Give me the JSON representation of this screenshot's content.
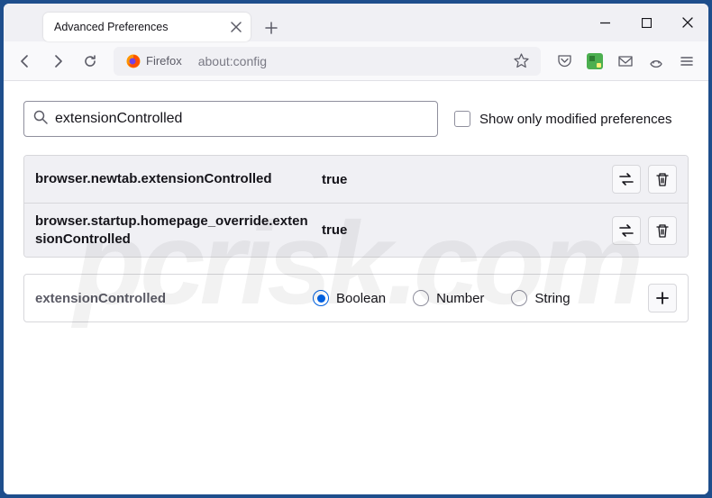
{
  "tab": {
    "title": "Advanced Preferences"
  },
  "nav": {
    "identity_label": "Firefox",
    "url": "about:config"
  },
  "search": {
    "value": "extensionControlled",
    "only_modified_label": "Show only modified preferences"
  },
  "prefs": [
    {
      "name": "browser.newtab.extensionControlled",
      "value": "true"
    },
    {
      "name": "browser.startup.homepage_override.extensionControlled",
      "value": "true"
    }
  ],
  "add_pref": {
    "name": "extensionControlled",
    "options": {
      "boolean": "Boolean",
      "number": "Number",
      "string": "String"
    }
  },
  "watermark": "pcrisk.com"
}
